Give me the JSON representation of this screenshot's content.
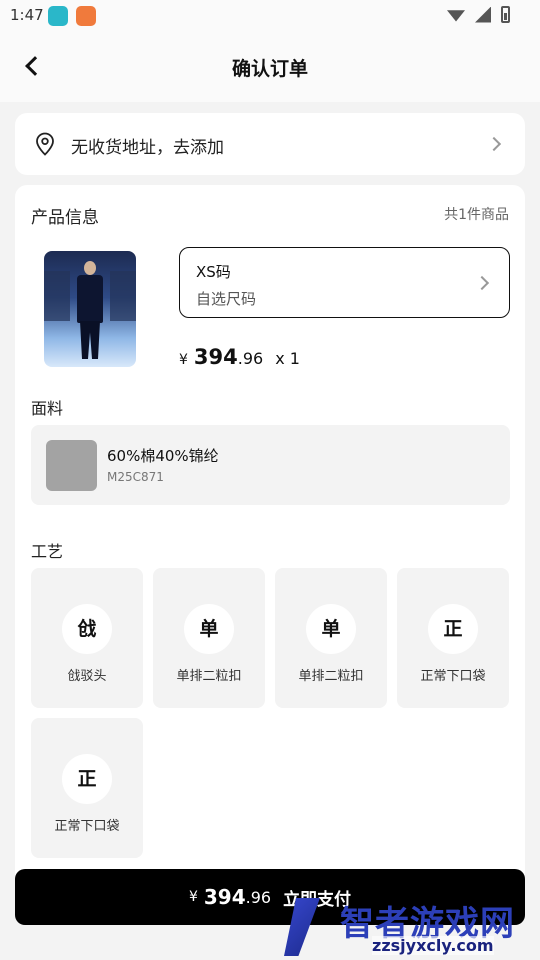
{
  "status_bar": {
    "time": "1:47"
  },
  "header": {
    "title": "确认订单"
  },
  "address": {
    "text": "无收货地址，去添加"
  },
  "product_section": {
    "title": "产品信息",
    "count": "共1件商品",
    "size": {
      "value": "XS码",
      "hint": "自选尺码"
    },
    "price": {
      "currency": "¥",
      "integer": "394",
      "decimal": ".96",
      "quantity": "x 1"
    }
  },
  "fabric": {
    "label": "面料",
    "name": "60%棉40%锦纶",
    "code": "M25C871",
    "swatch_color": "#a3a3a3"
  },
  "craft": {
    "label": "工艺",
    "items": [
      {
        "icon_char": "戗",
        "name": "戗驳头"
      },
      {
        "icon_char": "单",
        "name": "单排二粒扣"
      },
      {
        "icon_char": "单",
        "name": "单排二粒扣"
      },
      {
        "icon_char": "正",
        "name": "正常下口袋"
      },
      {
        "icon_char": "正",
        "name": "正常下口袋"
      }
    ]
  },
  "pay_bar": {
    "currency": "¥",
    "integer": "394",
    "decimal": ".96",
    "label": "立即支付"
  },
  "watermark": {
    "title": "智者游戏网",
    "url": "zzsjyxcly.com"
  },
  "colors": {
    "accent": "#000000",
    "background": "#f3f3f3",
    "card": "#ffffff"
  }
}
